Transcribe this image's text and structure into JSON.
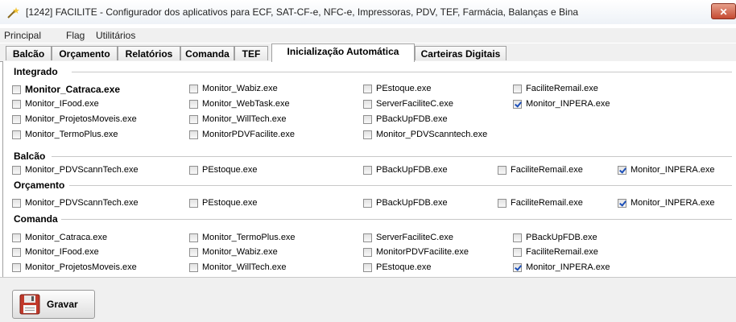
{
  "window": {
    "title": "[1242] FACILITE - Configurador dos aplicativos para ECF, SAT-CF-e, NFC-e, Impressoras, PDV, TEF, Farmácia, Balanças e Bina",
    "close_label": "✕"
  },
  "menu": [
    "Principal",
    "Flag",
    "Utilitários"
  ],
  "tabs": [
    "Balcão",
    "Orçamento",
    "Relatórios",
    "Comanda",
    "TEF",
    "Inicialização Automática",
    "Carteiras Digitais"
  ],
  "active_tab": "Inicialização Automática",
  "groups": {
    "integrado": {
      "title": "Integrado",
      "items": [
        {
          "label": "Monitor_Catraca.exe",
          "checked": false
        },
        {
          "label": "Monitor_Wabiz.exe",
          "checked": false
        },
        {
          "label": "PEstoque.exe",
          "checked": false
        },
        {
          "label": "FaciliteRemail.exe",
          "checked": false
        },
        {
          "label": "Monitor_IFood.exe",
          "checked": false
        },
        {
          "label": "Monitor_WebTask.exe",
          "checked": false
        },
        {
          "label": "ServerFaciliteC.exe",
          "checked": false
        },
        {
          "label": "Monitor_INPERA.exe",
          "checked": true
        },
        {
          "label": "Monitor_ProjetosMoveis.exe",
          "checked": false
        },
        {
          "label": "Monitor_WillTech.exe",
          "checked": false
        },
        {
          "label": "PBackUpFDB.exe",
          "checked": false
        },
        {
          "label": "Monitor_TermoPlus.exe",
          "checked": false
        },
        {
          "label": "MonitorPDVFacilite.exe",
          "checked": false
        },
        {
          "label": "Monitor_PDVScanntech.exe",
          "checked": false
        }
      ]
    },
    "balcao": {
      "title": "Balcão",
      "items": [
        {
          "label": "Monitor_PDVScannTech.exe",
          "checked": false
        },
        {
          "label": "PEstoque.exe",
          "checked": false
        },
        {
          "label": "PBackUpFDB.exe",
          "checked": false
        },
        {
          "label": "FaciliteRemail.exe",
          "checked": false
        },
        {
          "label": "Monitor_INPERA.exe",
          "checked": true
        }
      ]
    },
    "orcamento": {
      "title": "Orçamento",
      "items": [
        {
          "label": "Monitor_PDVScannTech.exe",
          "checked": false
        },
        {
          "label": "PEstoque.exe",
          "checked": false
        },
        {
          "label": "PBackUpFDB.exe",
          "checked": false
        },
        {
          "label": "FaciliteRemail.exe",
          "checked": false
        },
        {
          "label": "Monitor_INPERA.exe",
          "checked": true
        }
      ]
    },
    "comanda": {
      "title": "Comanda",
      "items": [
        {
          "label": "Monitor_Catraca.exe",
          "checked": false
        },
        {
          "label": "Monitor_TermoPlus.exe",
          "checked": false
        },
        {
          "label": "ServerFaciliteC.exe",
          "checked": false
        },
        {
          "label": "PBackUpFDB.exe",
          "checked": false
        },
        {
          "label": "Monitor_IFood.exe",
          "checked": false
        },
        {
          "label": "Monitor_Wabiz.exe",
          "checked": false
        },
        {
          "label": "MonitorPDVFacilite.exe",
          "checked": false
        },
        {
          "label": "FaciliteRemail.exe",
          "checked": false
        },
        {
          "label": "Monitor_ProjetosMoveis.exe",
          "checked": false
        },
        {
          "label": "Monitor_WillTech.exe",
          "checked": false
        },
        {
          "label": "PEstoque.exe",
          "checked": false
        },
        {
          "label": "Monitor_INPERA.exe",
          "checked": true
        }
      ]
    }
  },
  "footer": {
    "save_label": "Gravar",
    "save_icon": "floppy-disk-icon"
  },
  "colors": {
    "check": "#1c4fb8",
    "close": "#c54a32",
    "save_icon": "#c0392b"
  }
}
